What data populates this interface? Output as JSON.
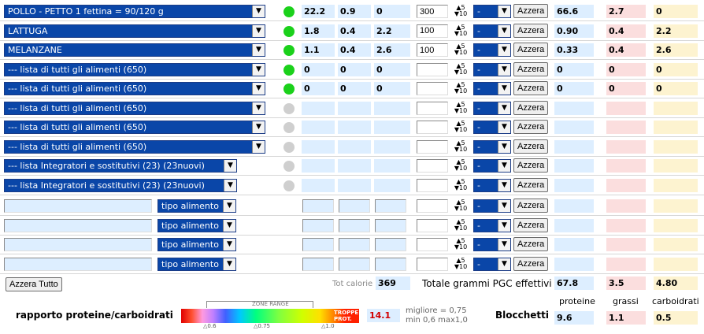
{
  "food_rows": [
    {
      "food": "POLLO - PETTO 1 fettina = 90/120 g",
      "status": "on",
      "p": "22.2",
      "g": "0.9",
      "c": "0",
      "qty": "300",
      "unit": "-",
      "btn": "Azzera",
      "tp": "66.6",
      "tg": "2.7",
      "tc": "0"
    },
    {
      "food": "LATTUGA",
      "status": "on",
      "p": "1.8",
      "g": "0.4",
      "c": "2.2",
      "qty": "100",
      "unit": "-",
      "btn": "Azzera",
      "tp": "0.90",
      "tg": "0.4",
      "tc": "2.2"
    },
    {
      "food": "MELANZANE",
      "status": "on",
      "p": "1.1",
      "g": "0.4",
      "c": "2.6",
      "qty": "100",
      "unit": "-",
      "btn": "Azzera",
      "tp": "0.33",
      "tg": "0.4",
      "tc": "2.6"
    },
    {
      "food": "--- lista di tutti gli alimenti (650)",
      "status": "on",
      "p": "0",
      "g": "0",
      "c": "0",
      "qty": "",
      "unit": "-",
      "btn": "Azzera",
      "tp": "0",
      "tg": "0",
      "tc": "0"
    },
    {
      "food": "--- lista di tutti gli alimenti (650)",
      "status": "on",
      "p": "0",
      "g": "0",
      "c": "0",
      "qty": "",
      "unit": "-",
      "btn": "Azzera",
      "tp": "0",
      "tg": "0",
      "tc": "0"
    },
    {
      "food": "--- lista di tutti gli alimenti (650)",
      "status": "off",
      "p": "",
      "g": "",
      "c": "",
      "qty": "",
      "unit": "-",
      "btn": "Azzera",
      "tp": "",
      "tg": "",
      "tc": ""
    },
    {
      "food": "--- lista di tutti gli alimenti (650)",
      "status": "off",
      "p": "",
      "g": "",
      "c": "",
      "qty": "",
      "unit": "-",
      "btn": "Azzera",
      "tp": "",
      "tg": "",
      "tc": ""
    },
    {
      "food": "--- lista di tutti gli alimenti (650)",
      "status": "off",
      "p": "",
      "g": "",
      "c": "",
      "qty": "",
      "unit": "-",
      "btn": "Azzera",
      "tp": "",
      "tg": "",
      "tc": ""
    }
  ],
  "supp_rows": [
    {
      "food": "--- lista Integratori e sostitutivi (23) (23nuovi)",
      "status": "off",
      "unit": "-",
      "btn": "Azzera"
    },
    {
      "food": "--- lista Integratori e sostitutivi (23) (23nuovi)",
      "status": "off",
      "unit": "-",
      "btn": "Azzera"
    }
  ],
  "custom_rows": [
    {
      "type": "tipo alimento",
      "unit": "-",
      "btn": "Azzera"
    },
    {
      "type": "tipo alimento",
      "unit": "-",
      "btn": "Azzera"
    },
    {
      "type": "tipo alimento",
      "unit": "-",
      "btn": "Azzera"
    },
    {
      "type": "tipo alimento",
      "unit": "-",
      "btn": "Azzera"
    }
  ],
  "spinner": {
    "up": "5",
    "down": "10"
  },
  "footer": {
    "reset_all": "Azzera Tutto",
    "tot_cal_label": "Tot calorie",
    "tot_cal": "369",
    "total_label": "Totale grammi PGC effettivi",
    "tot_p": "67.8",
    "tot_g": "3.5",
    "tot_c": "4.80",
    "head_p": "proteine",
    "head_g": "grassi",
    "head_c": "carboidrati",
    "ratio_label": "rapporto proteine/carboidrati",
    "zone_range": "ZONE RANGE",
    "gauge_marks": [
      "0.6",
      "0.75",
      "1.0"
    ],
    "too_much": "TROPPE PROT.",
    "ratio_value": "14.1",
    "best": "migliore = 0,75",
    "minmax": "min 0,6 max1,0",
    "blocks_label": "Blocchetti",
    "blk_p": "9.6",
    "blk_g": "1.1",
    "blk_c": "0.5"
  },
  "colors": {
    "select": "#0a46a8",
    "dot_on": "#1bd11b",
    "dot_off": "#cfcfcf",
    "protein": "#ddeeff",
    "fat": "#fbdede",
    "carb": "#fdf3d0",
    "ratio": "#d20000"
  }
}
